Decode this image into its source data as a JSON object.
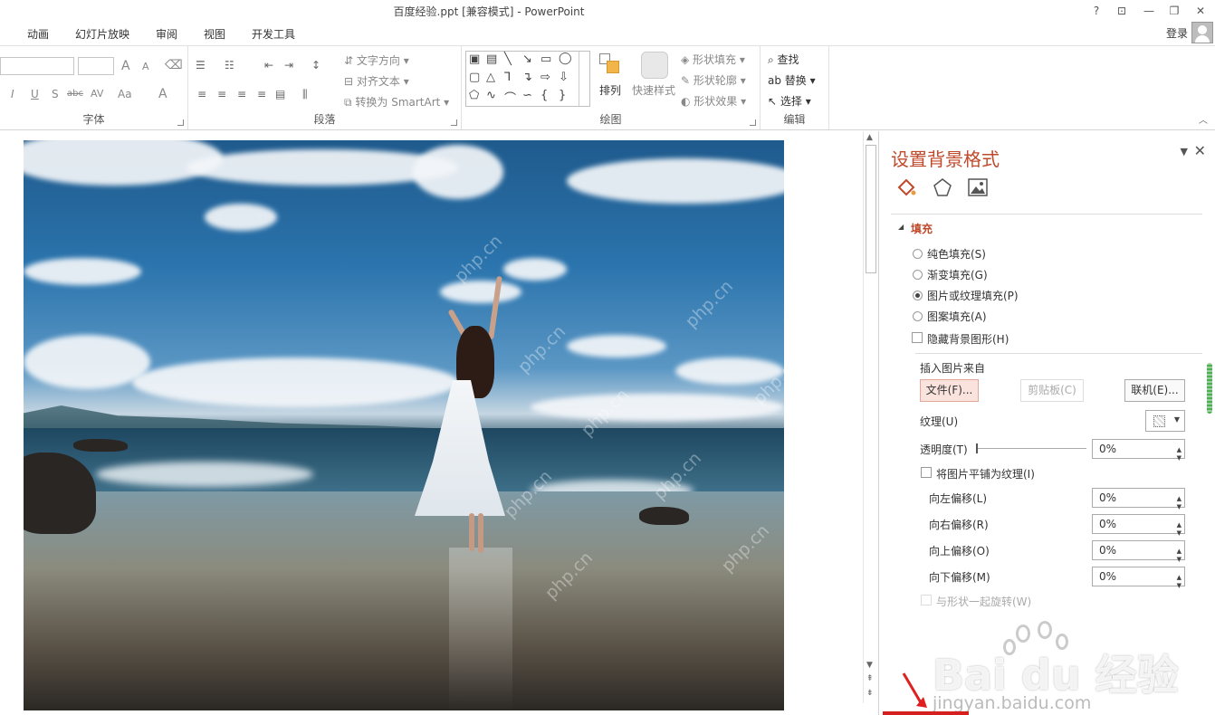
{
  "window": {
    "title": "百度经验.ppt [兼容模式] - PowerPoint",
    "help": "?",
    "ribbon_opts": "⊡",
    "minimize": "—",
    "restore": "❐",
    "close": "✕"
  },
  "menu": {
    "tabs": [
      "动画",
      "幻灯片放映",
      "审阅",
      "视图",
      "开发工具"
    ],
    "login": "登录"
  },
  "ribbon": {
    "font_group": {
      "label": "字体",
      "grow": "A",
      "shrink": "A",
      "italic": "I",
      "underline": "U",
      "shadow": "S",
      "strike": "abc",
      "spacing": "AV",
      "case": "Aa",
      "color": "A"
    },
    "paragraph_group": {
      "label": "段落",
      "text_direction": "文字方向",
      "align_text": "对齐文本",
      "convert_smartart": "转换为 SmartArt"
    },
    "drawing_group": {
      "label": "绘图",
      "arrange": "排列",
      "quick_styles": "快速样式",
      "shape_fill": "形状填充",
      "shape_outline": "形状轮廓",
      "shape_effects": "形状效果"
    },
    "editing_group": {
      "label": "编辑",
      "find": "查找",
      "replace": "替换",
      "select": "选择"
    }
  },
  "slide": {
    "watermarks": [
      "php.cn",
      "php.cn",
      "php.cn",
      "php.cn",
      "php.cn",
      "php.cn",
      "php.cn",
      "php.cn",
      "php.cn"
    ]
  },
  "pane": {
    "title": "设置背景格式",
    "menu_arrow": "▼",
    "close": "✕",
    "section_fill": "填充",
    "options": {
      "solid": "纯色填充(S)",
      "gradient": "渐变填充(G)",
      "picture": "图片或纹理填充(P)",
      "pattern": "图案填充(A)"
    },
    "hide_bg": "隐藏背景图形(H)",
    "insert_from": "插入图片来自",
    "btn_file": "文件(F)...",
    "btn_clipboard": "剪贴板(C)",
    "btn_online": "联机(E)...",
    "texture": "纹理(U)",
    "transparency": "透明度(T)",
    "transparency_value": "0%",
    "tile": "将图片平铺为纹理(I)",
    "offset_left": "向左偏移(L)",
    "offset_left_value": "0%",
    "offset_right": "向右偏移(R)",
    "offset_right_value": "0%",
    "offset_top": "向上偏移(O)",
    "offset_top_value": "0%",
    "offset_bottom": "向下偏移(M)",
    "offset_bottom_value": "0%",
    "rotate": "与形状一起旋转(W)"
  },
  "watermark": {
    "brand": "Bai  du 经验",
    "url": "jingyan.baidu.com"
  }
}
